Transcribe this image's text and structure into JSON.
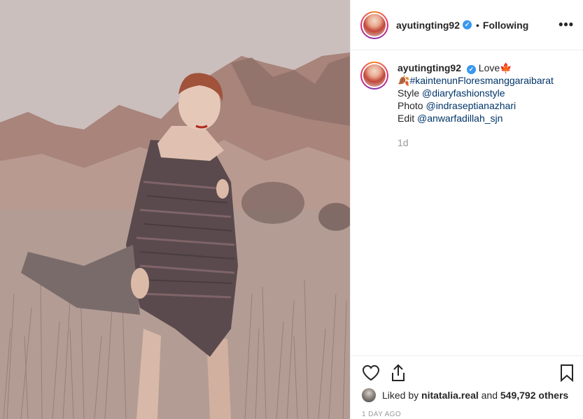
{
  "post": {
    "username": "ayutingting92",
    "verified_mark": "✓",
    "dot": "•",
    "follow_state": "Following",
    "more_label": "•••"
  },
  "caption": {
    "username": "ayutingting92",
    "line1_text": "Love",
    "line1_emoji": "🍁",
    "line2_emoji": "🍂",
    "hashtag": "#kaintenunFloresmanggaraibarat",
    "style_label": "Style",
    "style_mention": "@diaryfashionstyle",
    "photo_label": "Photo",
    "photo_mention": "@indraseptianazhari",
    "edit_label": "Edit",
    "edit_mention": "@anwarfadillah_sjn",
    "time": "1d"
  },
  "actions": {
    "like_icon": "heart-icon",
    "share_icon": "share-icon",
    "save_icon": "bookmark-icon"
  },
  "likes": {
    "prefix": "Liked by",
    "user": "nitatalia.real",
    "conj": "and",
    "count": "549,792 others"
  },
  "timestamp": "1 DAY AGO",
  "colors": {
    "link": "#003569",
    "verified": "#3897f0",
    "muted": "#999999",
    "border": "#efefef"
  }
}
